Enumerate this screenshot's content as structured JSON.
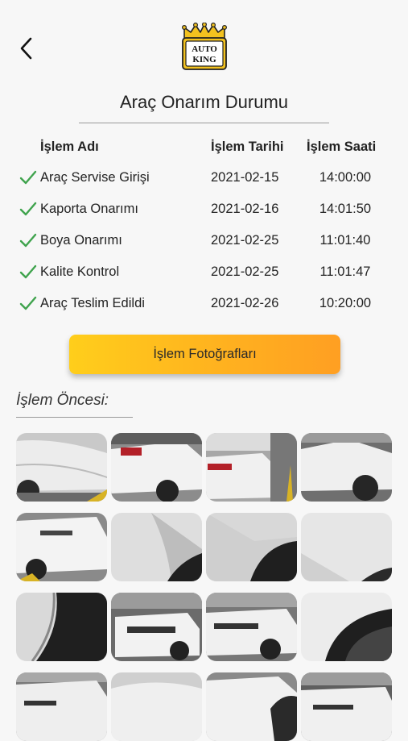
{
  "header": {
    "logo_text_top": "AUTO",
    "logo_text_bottom": "KING",
    "title": "Araç Onarım Durumu"
  },
  "table": {
    "columns": [
      "İşlem Adı",
      "İşlem Tarihi",
      "İşlem Saati"
    ],
    "rows": [
      {
        "name": "Araç Servise Girişi",
        "date": "2021-02-15",
        "time": "14:00:00",
        "done": true
      },
      {
        "name": "Kaporta Onarımı",
        "date": "2021-02-16",
        "time": "14:01:50",
        "done": true
      },
      {
        "name": "Boya Onarımı",
        "date": "2021-02-25",
        "time": "11:01:40",
        "done": true
      },
      {
        "name": "Kalite Kontrol",
        "date": "2021-02-25",
        "time": "11:01:47",
        "done": true
      },
      {
        "name": "Araç Teslim Edildi",
        "date": "2021-02-26",
        "time": "10:20:00",
        "done": true
      }
    ]
  },
  "photos_button_label": "İşlem Fotoğrafları",
  "section_label": "İşlem Öncesi:",
  "colors": {
    "check": "#3fa34d",
    "button_start": "#ffce1b",
    "button_end": "#ff9f22",
    "logo_gold": "#f3c21f"
  }
}
